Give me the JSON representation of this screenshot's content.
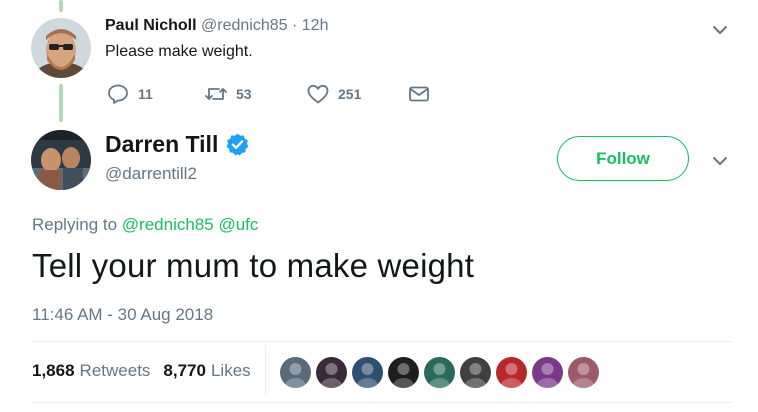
{
  "reply": {
    "name": "Paul Nicholl",
    "handle": "@rednich85",
    "separator": "·",
    "time": "12h",
    "text": "Please make weight.",
    "actions": {
      "replies": "11",
      "retweets": "53",
      "likes": "251"
    }
  },
  "tweet": {
    "name": "Darren Till",
    "handle": "@darrentill2",
    "follow_label": "Follow",
    "replying_prefix": "Replying to",
    "replying_to": [
      "@rednich85",
      "@ufc"
    ],
    "text": "Tell your mum to make weight",
    "timestamp": "11:46 AM - 30 Aug 2018",
    "stats": {
      "retweets_count": "1,868",
      "retweets_label": "Retweets",
      "likes_count": "8,770",
      "likes_label": "Likes"
    }
  },
  "icons": {
    "reply": "reply-icon",
    "retweet": "retweet-icon",
    "like": "heart-icon",
    "dm": "envelope-icon",
    "more": "chevron-down-icon",
    "verified": "verified-badge-icon"
  },
  "colors": {
    "accent_green": "#17bf63",
    "thread_line": "#b0d9b9",
    "muted_text": "#657786",
    "verified_blue": "#1da1f2"
  },
  "liker_colors": [
    "#5a6a7a",
    "#3b2a3a",
    "#2f4f6f",
    "#1e1e1e",
    "#2a6a5a",
    "#404040",
    "#b8282b",
    "#7a3a8a",
    "#9a5a6a"
  ]
}
